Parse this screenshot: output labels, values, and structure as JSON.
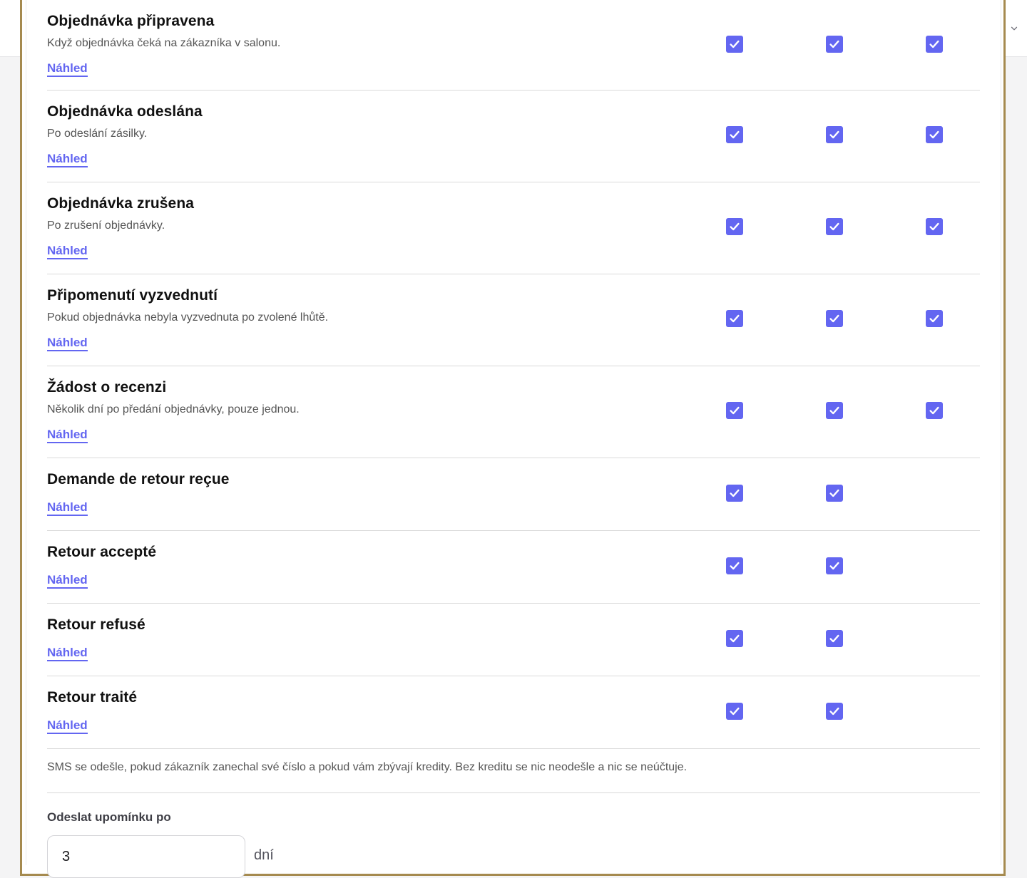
{
  "notifications": [
    {
      "title": "Objednávka připravena",
      "description": "Když objednávka čeká na zákazníka v salonu.",
      "preview_label": "Náhled",
      "checks": [
        true,
        true,
        true
      ]
    },
    {
      "title": "Objednávka odeslána",
      "description": "Po odeslání zásilky.",
      "preview_label": "Náhled",
      "checks": [
        true,
        true,
        true
      ]
    },
    {
      "title": "Objednávka zrušena",
      "description": "Po zrušení objednávky.",
      "preview_label": "Náhled",
      "checks": [
        true,
        true,
        true
      ]
    },
    {
      "title": "Připomenutí vyzvednutí",
      "description": "Pokud objednávka nebyla vyzvednuta po zvolené lhůtě.",
      "preview_label": "Náhled",
      "checks": [
        true,
        true,
        true
      ]
    },
    {
      "title": "Žádost o recenzi",
      "description": "Několik dní po předání objednávky, pouze jednou.",
      "preview_label": "Náhled",
      "checks": [
        true,
        true,
        true
      ]
    },
    {
      "title": "Demande de retour reçue",
      "description": "",
      "preview_label": "Náhled",
      "checks": [
        true,
        true
      ]
    },
    {
      "title": "Retour accepté",
      "description": "",
      "preview_label": "Náhled",
      "checks": [
        true,
        true
      ]
    },
    {
      "title": "Retour refusé",
      "description": "",
      "preview_label": "Náhled",
      "checks": [
        true,
        true
      ]
    },
    {
      "title": "Retour traité",
      "description": "",
      "preview_label": "Náhled",
      "checks": [
        true,
        true
      ]
    }
  ],
  "sms_note": "SMS se odešle, pokud zákazník zanechal své číslo a pokud vám zbývají kredity. Bez kreditu se nic neodešle a nic se neúčtuje.",
  "reminder": {
    "label": "Odeslat upomínku po",
    "value": "3",
    "unit": "dní"
  },
  "colors": {
    "accent": "#6366f1",
    "frame_border": "#a58a4f"
  },
  "icons": {
    "topbar": "chevron-down-icon",
    "checkbox": "checkmark-icon"
  }
}
